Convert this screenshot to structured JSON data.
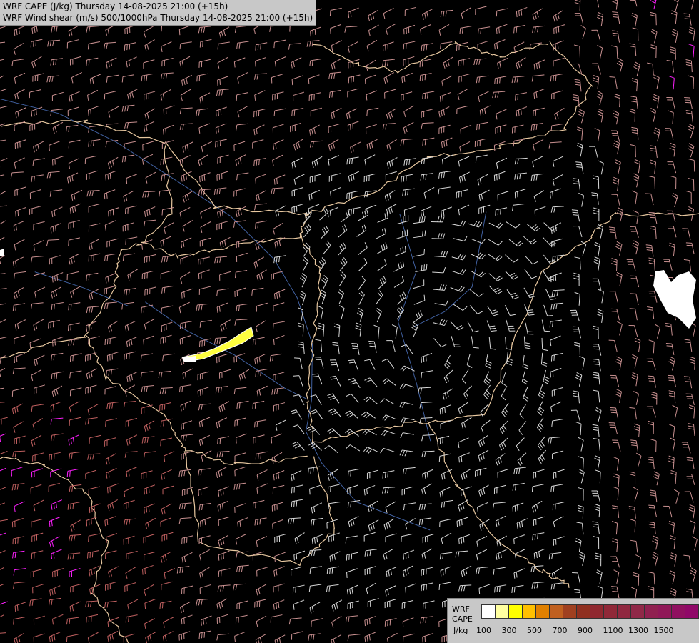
{
  "titles": {
    "line1": "WRF CAPE (J/kg) Thursday 14-08-2025 21:00 (+15h)",
    "line2": "WRF Wind shear (m/s) 500/1000hPa Thursday 14-08-2025 21:00 (+15h)"
  },
  "legend": {
    "label_top": "WRF",
    "label_mid": "CAPE",
    "label_unit": "J/kg",
    "ticks": [
      "100",
      "300",
      "500",
      "700",
      "900",
      "1100",
      "1300",
      "1500"
    ],
    "colors": [
      "#ffffff",
      "#ffffa0",
      "#ffff00",
      "#ffc000",
      "#e08000",
      "#c06020",
      "#a04020",
      "#903020",
      "#902830",
      "#902838",
      "#902840",
      "#902848",
      "#902050",
      "#901858",
      "#901060",
      "#900868"
    ]
  },
  "map": {
    "background": "#000000",
    "barb_colors": {
      "low": "#d8d8d8",
      "mid": "#c89090",
      "high": "#c06060",
      "strong": "#ff20ff"
    },
    "border_color": "#e8c8a0",
    "river_color": "#4060a0"
  }
}
